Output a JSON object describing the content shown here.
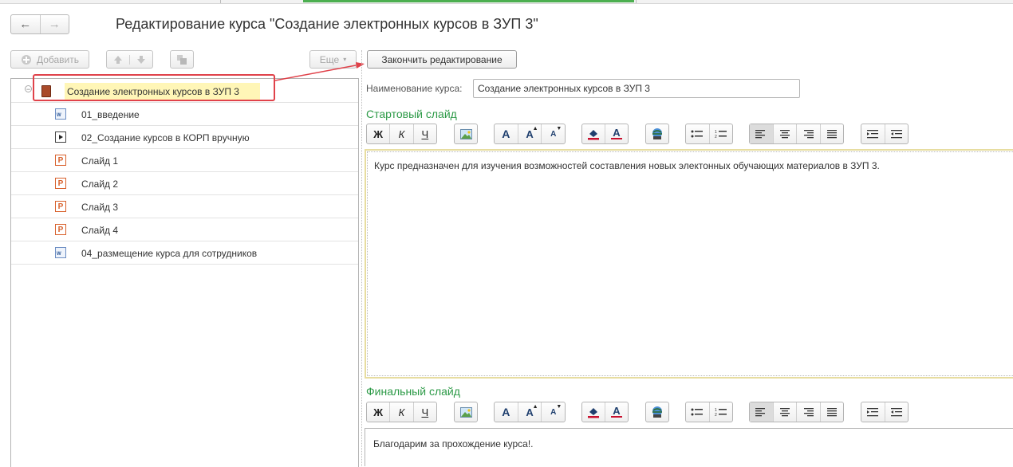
{
  "window": {
    "title": "Редактирование курса \"Создание электронных курсов в ЗУП 3\""
  },
  "nav": {
    "back_icon": "arrow-left-icon",
    "forward_icon": "arrow-right-icon"
  },
  "toolbar": {
    "add_label": "Добавить",
    "more_label": "Еще",
    "finish_label": "Закончить редактирование"
  },
  "tree": {
    "root": {
      "label": "Создание электронных курсов в ЗУП 3",
      "icon": "course-book-icon"
    },
    "items": [
      {
        "label": "01_введение",
        "icon": "word-document-icon"
      },
      {
        "label": "02_Создание курсов в КОРП вручную",
        "icon": "video-icon"
      },
      {
        "label": "Слайд 1",
        "icon": "powerpoint-slide-icon"
      },
      {
        "label": "Слайд 2",
        "icon": "powerpoint-slide-icon"
      },
      {
        "label": "Слайд 3",
        "icon": "powerpoint-slide-icon"
      },
      {
        "label": "Слайд 4",
        "icon": "powerpoint-slide-icon"
      },
      {
        "label": "04_размещение курса для сотрудников",
        "icon": "word-document-icon"
      }
    ]
  },
  "form": {
    "name_label": "Наименование курса:",
    "name_value": "Создание электронных курсов в ЗУП 3",
    "start_slide_label": "Стартовый слайд",
    "start_slide_text": "Курс предназначен для изучения возможностей составления новых электонных обучающих материалов в ЗУП 3.",
    "final_slide_label": "Финальный слайд",
    "final_slide_text": "Благодарим за прохождение курса!."
  },
  "format": {
    "bold": "Ж",
    "italic": "К",
    "underline": "Ч",
    "font_a": "A"
  },
  "colors": {
    "section_green": "#2c9a47",
    "callout_red": "#e0424a",
    "highlight_yellow": "#fff6b7",
    "tab_green": "#4caf50"
  }
}
